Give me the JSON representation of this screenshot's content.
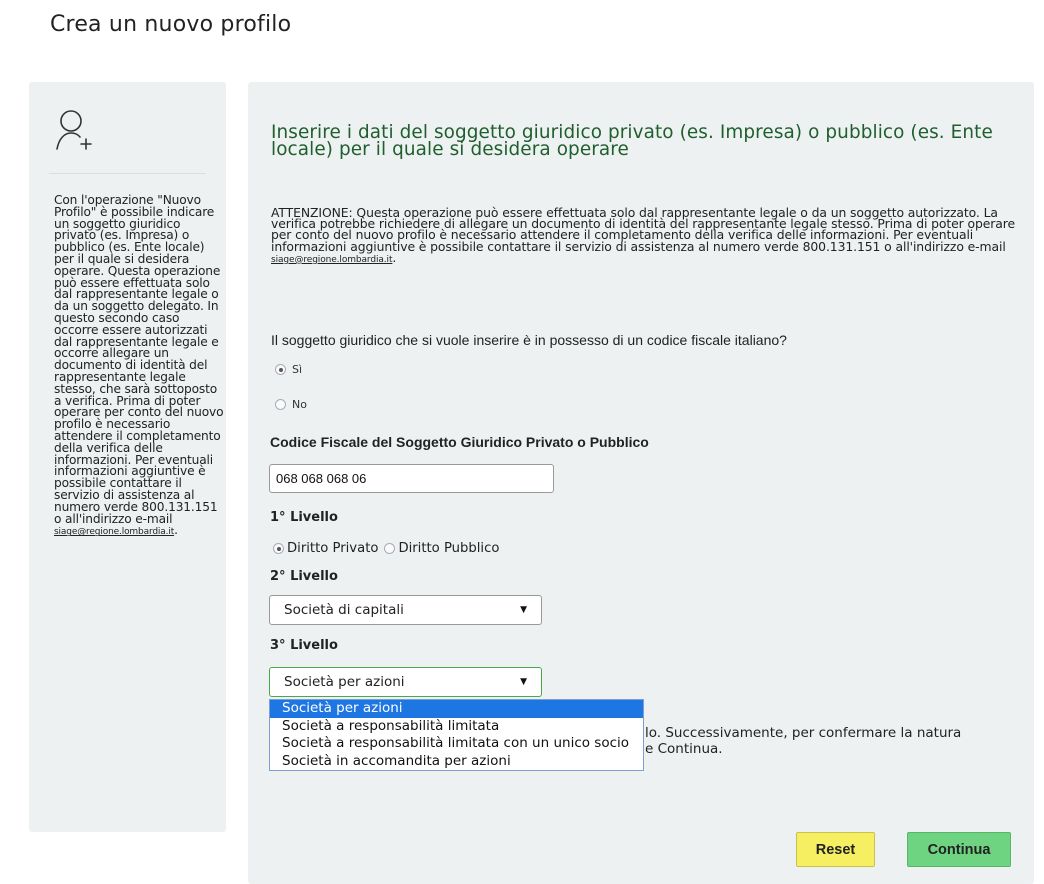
{
  "page_title": "Crea un nuovo profilo",
  "sidebar": {
    "icon": "add-user-icon",
    "help_text": "Con l'operazione \"Nuovo Profilo\" è possibile indicare un soggetto giuridico privato (es. Impresa) o pubblico (es. Ente locale) per il quale si desidera operare. Questa operazione può essere effettuata solo dal rappresentante legale o da un soggetto delegato. In questo secondo caso occorre essere autorizzati dal rappresentante legale e occorre allegare un documento di identità del rappresentante legale stesso, che sarà sottoposto a verifica. Prima di poter operare per conto del nuovo profilo è necessario attendere il completamento della verifica delle informazioni. Per eventuali informazioni aggiuntive è possibile contattare il servizio di assistenza al numero verde 800.131.151 o all'indirizzo e-mail",
    "email": "siage@regione.lombardia.it"
  },
  "main": {
    "heading": "Inserire i dati del soggetto giuridico privato (es. Impresa) o pubblico (es. Ente locale) per il quale si desidera operare",
    "warning_text": "ATTENZIONE: Questa operazione può essere effettuata solo dal rappresentante legale o da un soggetto autorizzato. La verifica potrebbe richiedere di allegare un documento di identità del rappresentante legale stesso. Prima di poter operare per conto del nuovo profilo è necessario attendere il completamento della verifica delle informazioni. Per eventuali informazioni aggiuntive è possibile contattare il servizio di assistenza al numero verde 800.131.151 o all'indirizzo e-mail",
    "warning_email": "siage@regione.lombardia.it",
    "warning_email_suffix": ".",
    "question": "Il soggetto giuridico che si vuole inserire è in possesso di un codice fiscale italiano?",
    "cf_options": [
      {
        "label": "Sì",
        "checked": true
      },
      {
        "label": "No",
        "checked": false
      }
    ],
    "cf_label": "Codice Fiscale del Soggetto Giuridico Privato o Pubblico",
    "cf_value": "068 068 068 06",
    "level1_label": "1° Livello",
    "level1_options": [
      {
        "label": "Diritto Privato",
        "checked": true
      },
      {
        "label": "Diritto Pubblico",
        "checked": false
      }
    ],
    "level2_label": "2° Livello",
    "level2_value": "Società di capitali",
    "level3_label": "3° Livello",
    "level3_value": "Società per azioni",
    "level3_options": [
      "Società per azioni",
      "Società a responsabilità limitata",
      "Società a responsabilità limitata con un unico socio",
      "Società in accomandita per azioni"
    ],
    "level3_selected_index": 0,
    "partial_line1": "lo. Successivamente, per confermare la natura",
    "partial_line2": "e Continua.",
    "reset_label": "Reset",
    "continue_label": "Continua"
  },
  "colors": {
    "heading": "#1f5e2e",
    "panel_bg": "#eef1f1",
    "reset_bg": "#f5ef61",
    "continue_bg": "#6fd482",
    "dropdown_selected": "#1e76e3"
  }
}
